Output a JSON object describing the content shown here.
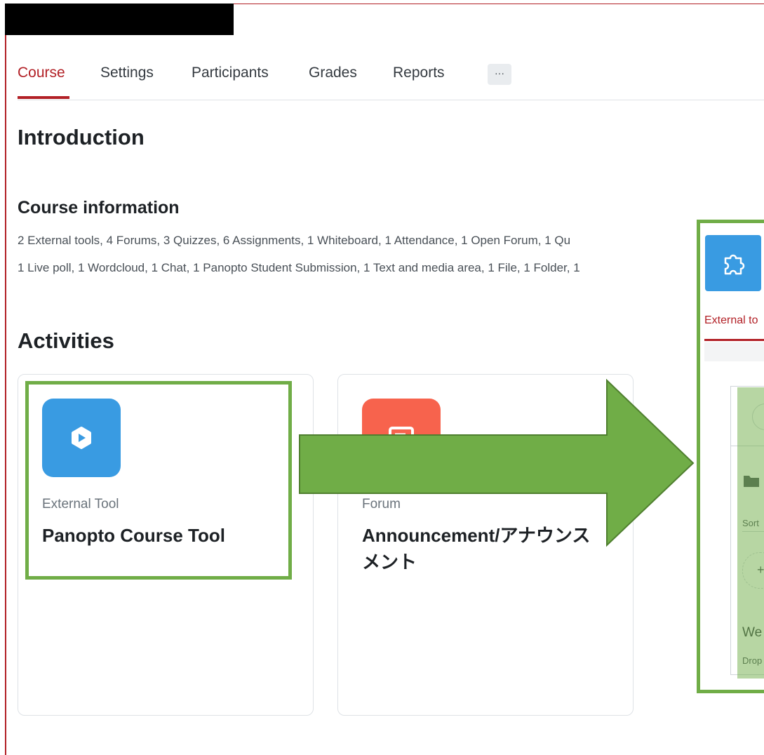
{
  "nav": {
    "tabs": [
      {
        "label": "Course",
        "active": true
      },
      {
        "label": "Settings",
        "active": false
      },
      {
        "label": "Participants",
        "active": false
      },
      {
        "label": "Grades",
        "active": false
      },
      {
        "label": "Reports",
        "active": false
      }
    ],
    "more_label": "···"
  },
  "introduction": {
    "heading": "Introduction",
    "course_info_heading": "Course information",
    "summary_lines": [
      "2 External tools, 4 Forums, 3 Quizzes, 6 Assignments, 1 Whiteboard, 1 Attendance, 1 Open Forum, 1 Qu",
      "1 Live poll, 1 Wordcloud, 1 Chat, 1 Panopto Student Submission, 1 Text and media area, 1 File, 1 Folder, 1"
    ]
  },
  "activities": {
    "heading": "Activities",
    "cards": [
      {
        "type": "External Tool",
        "name": "Panopto Course Tool",
        "icon": "play-hexagon-icon",
        "color": "#399be2"
      },
      {
        "type": "Forum",
        "name": "Announcement/アナウンスメント",
        "icon": "forum-icon",
        "color": "#f7634d"
      }
    ]
  },
  "preview": {
    "icon": "puzzle-icon",
    "tab_label": "External to",
    "sort_label": "Sort",
    "plus_label": "+",
    "welcome_text": "We",
    "drop_text": "Drop"
  },
  "colors": {
    "brand_red": "#b22026",
    "highlight_green": "#70ad47",
    "panopto_blue": "#399be2",
    "forum_orange": "#f7634d"
  }
}
